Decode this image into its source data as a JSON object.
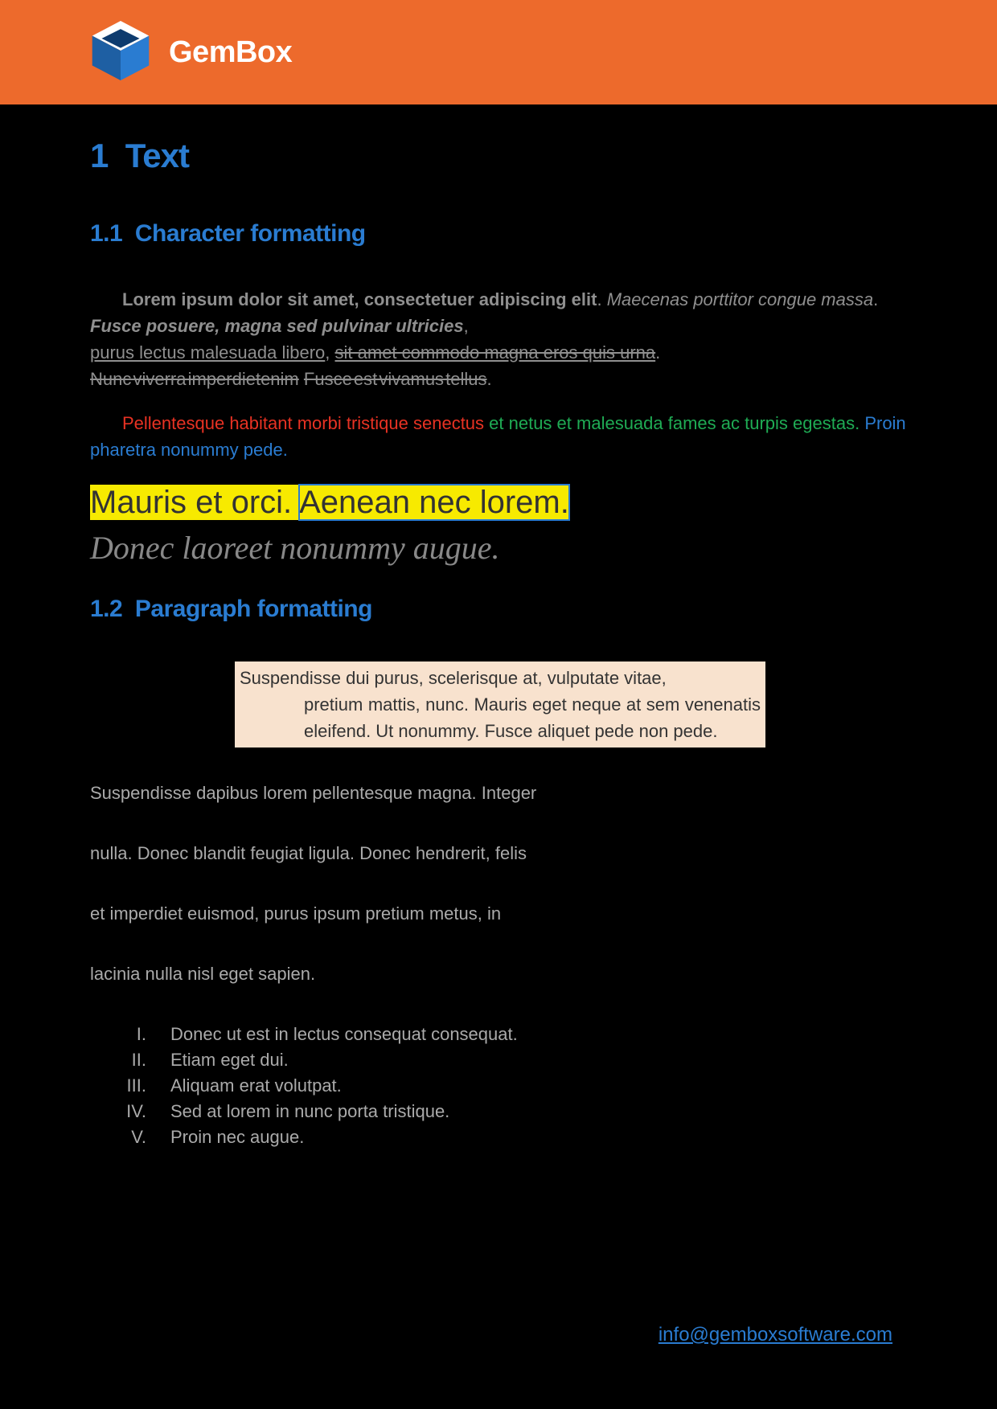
{
  "header": {
    "brand": "GemBox"
  },
  "sections": {
    "s1": {
      "num": "1",
      "title": "Text"
    },
    "s11": {
      "num": "1.1",
      "title": "Character formatting"
    },
    "s12": {
      "num": "1.2",
      "title": "Paragraph formatting"
    }
  },
  "char": {
    "a": "Lorem ipsum dolor sit amet, consectetuer adipiscing elit",
    "dot1": ". ",
    "b": "Maecenas porttitor congue massa",
    "dot2": ". ",
    "c": "Fusce posuere, magna sed pulvinar ultricies",
    "comma1": ",",
    "d": "purus lectus malesuada libero",
    "comma2": ", ",
    "e": "sit amet commodo magna eros quis urna",
    "dot3": ".",
    "f": "Nunc viverra imperdietenim",
    "space1": " ",
    "g": "Fusce est vivamus tellus",
    "dot4": ".",
    "h": "Pellentesque habitant morbi tristique senectus ",
    "i": "et netus et malesuada fames ac turpis egestas. ",
    "j": "Proin pharetra nonummy pede.",
    "k": "Mauris et orci. ",
    "l": "Aenean nec lorem.",
    "m": "Donec laoreet nonummy augue."
  },
  "para": {
    "box_first": "Suspendisse dui purus, scelerisque at, vulputate vitae,",
    "box_rest": "pretium mattis, nunc. Mauris eget neque at sem venenatis eleifend. Ut nonummy. Fusce aliquet pede non pede.",
    "spread1": "Suspendisse dapibus lorem pellentesque magna. Integer",
    "spread2": "nulla. Donec blandit feugiat ligula. Donec hendrerit, felis",
    "spread3": "et imperdiet euismod, purus ipsum pretium metus, in",
    "spread4": "lacinia nulla nisl eget sapien."
  },
  "list": [
    {
      "n": "I.",
      "t": "Donec ut est in lectus consequat consequat."
    },
    {
      "n": "II.",
      "t": "Etiam eget dui."
    },
    {
      "n": "III.",
      "t": "Aliquam erat volutpat."
    },
    {
      "n": "IV.",
      "t": "Sed at lorem in nunc porta tristique."
    },
    {
      "n": "V.",
      "t": "Proin nec augue."
    }
  ],
  "footer": {
    "email": "info@gemboxsoftware.com"
  }
}
